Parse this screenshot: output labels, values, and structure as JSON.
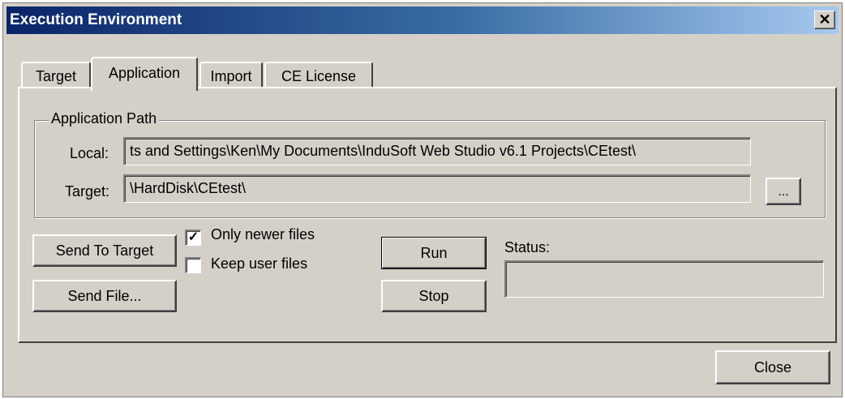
{
  "window": {
    "title": "Execution Environment",
    "close_glyph": "✕"
  },
  "tabs": [
    {
      "label": "Target",
      "active": false
    },
    {
      "label": "Application",
      "active": true
    },
    {
      "label": "Import",
      "active": false
    },
    {
      "label": "CE License",
      "active": false
    }
  ],
  "application_path": {
    "group_label": "Application Path",
    "local_label": "Local:",
    "local_value": "ts and Settings\\Ken\\My Documents\\InduSoft Web Studio v6.1 Projects\\CEtest\\",
    "target_label": "Target:",
    "target_value": "\\HardDisk\\CEtest\\",
    "browse_label": "..."
  },
  "actions": {
    "send_to_target": "Send To Target",
    "send_file": "Send File...",
    "only_newer_files": {
      "label": "Only newer files",
      "checked": true,
      "mark": "✓"
    },
    "keep_user_files": {
      "label": "Keep user files",
      "checked": false
    },
    "run": "Run",
    "stop": "Stop",
    "status_label": "Status:",
    "status_value": ""
  },
  "footer": {
    "close": "Close"
  },
  "colors": {
    "face": "#d4d0c8",
    "title_start": "#0a246a",
    "title_end": "#a6caf0"
  }
}
